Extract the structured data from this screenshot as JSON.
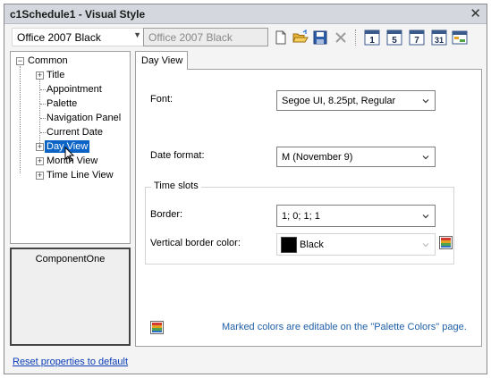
{
  "window": {
    "title": "c1Schedule1 - Visual Style",
    "close_glyph": "✕"
  },
  "toolbar": {
    "style_select_value": "Office 2007 Black",
    "style_name_value": "Office 2007 Black",
    "buttons": {
      "new": "new-icon",
      "open": "folder-open-icon",
      "save": "save-icon",
      "delete": "delete-icon",
      "day": "1",
      "work_week": "5",
      "week": "7",
      "month": "31"
    }
  },
  "tree": {
    "root": "Common",
    "children": [
      "Title",
      "Appointment",
      "Palette",
      "Navigation Panel",
      "Current Date"
    ],
    "siblings": [
      "Day View",
      "Month View",
      "Time Line View"
    ],
    "selected": "Day View"
  },
  "logo_box": {
    "text": "ComponentOne"
  },
  "reset_link": "Reset properties to default",
  "tabs": [
    {
      "label": "Day View",
      "active": true
    }
  ],
  "form": {
    "font_label": "Font:",
    "font_value": "Segoe UI, 8.25pt, Regular",
    "date_format_label": "Date format:",
    "date_format_value": "M (November 9)",
    "time_slots_group": "Time slots",
    "border_label": "Border:",
    "border_value": "1; 0; 1; 1",
    "vborder_label": "Vertical border color:",
    "vborder_value": "Black",
    "vborder_swatch": "#000000"
  },
  "note": "Marked colors are editable on the \"Palette Colors\" page.",
  "colors": {
    "selection": "#0b63c5",
    "link": "#0a3cb8",
    "note": "#1f5fa8"
  }
}
